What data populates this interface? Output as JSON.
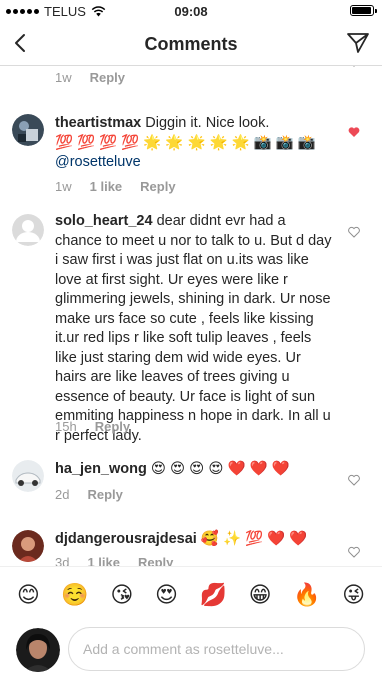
{
  "status": {
    "carrier": "TELUS",
    "time": "09:08",
    "battery_level": 0.95
  },
  "nav": {
    "title": "Comments"
  },
  "comments": [
    {
      "meta_time": "1w",
      "reply": "Reply"
    },
    {
      "username": "theartistmax",
      "text": "Diggin it. Nice look.",
      "text2": "💯 💯 💯 💯 🌟 🌟 🌟 🌟 🌟 📸 📸 📸",
      "mention": "@rosetteluve",
      "meta_time": "1w",
      "likes": "1 like",
      "reply": "Reply",
      "heart_color": "#ed4956"
    },
    {
      "username": "solo_heart_24",
      "text": "dear didnt evr had a chance to meet u nor to talk to u. But d day i saw first i was just flat on u.its was like love at first sight. Ur eyes were like r glimmering jewels, shining in dark. Ur nose make urs face so cute , feels like kissing it.ur red lips r like soft tulip leaves , feels like just staring dem wid wide eyes. Ur hairs are like leaves of trees giving u essence of beauty. Ur face is light of sun emmiting happiness n hope in dark. In all u r perfect lady.",
      "meta_time": "15h",
      "reply": "Reply"
    },
    {
      "username": "ha_jen_wong",
      "text": "😍 😍 😍 😍 ❤️ ❤️ ❤️",
      "meta_time": "2d",
      "reply": "Reply"
    },
    {
      "username": "djdangerousrajdesai",
      "text": "🥰 ✨ 💯 ❤️ ❤️",
      "meta_time": "3d",
      "likes": "1 like",
      "reply": "Reply"
    }
  ],
  "emoji_bar": [
    "😊",
    "☺️",
    "😘",
    "😍",
    "💋",
    "😁",
    "🔥",
    "😜"
  ],
  "composer": {
    "placeholder": "Add a comment as rosetteluve..."
  },
  "colors": {
    "accent_heart": "#ed4956",
    "meta_gray": "#999999",
    "link": "#003569"
  }
}
